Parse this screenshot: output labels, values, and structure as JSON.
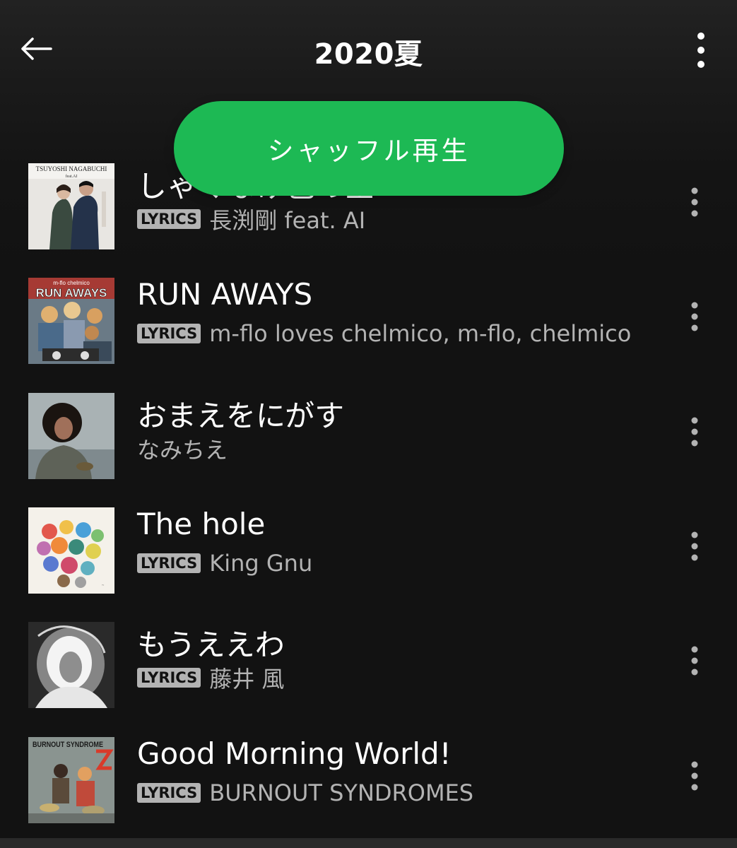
{
  "header": {
    "title": "2020夏",
    "shuffle_label": "シャッフル再生"
  },
  "badge_label": "LYRICS",
  "tracks": [
    {
      "title": "しゃくなげ色の空",
      "artist": "長渕剛 feat. AI",
      "lyrics": true
    },
    {
      "title": "RUN AWAYS",
      "artist": "m-flo loves chelmico, m-flo, chelmico",
      "lyrics": true
    },
    {
      "title": "おまえをにがす",
      "artist": "なみちえ",
      "lyrics": false
    },
    {
      "title": "The hole",
      "artist": "King Gnu",
      "lyrics": true
    },
    {
      "title": "もうええわ",
      "artist": "藤井 風",
      "lyrics": true
    },
    {
      "title": "Good Morning World!",
      "artist": "BURNOUT SYNDROMES",
      "lyrics": true
    }
  ],
  "cover_texts": {
    "t0_top": "TSUYOSHI NAGABUCHI",
    "t0_sub": "feat.AI",
    "t1_top": "m-flo chelmico",
    "t1_main": "RUN AWAYS",
    "t5_main": "BURNOUT SYNDROME"
  },
  "colors": {
    "background": "#121212",
    "accent": "#1db954",
    "secondary_text": "#b3b3b3"
  },
  "icons": {
    "back": "arrow-left-icon",
    "more": "more-vertical-icon"
  }
}
